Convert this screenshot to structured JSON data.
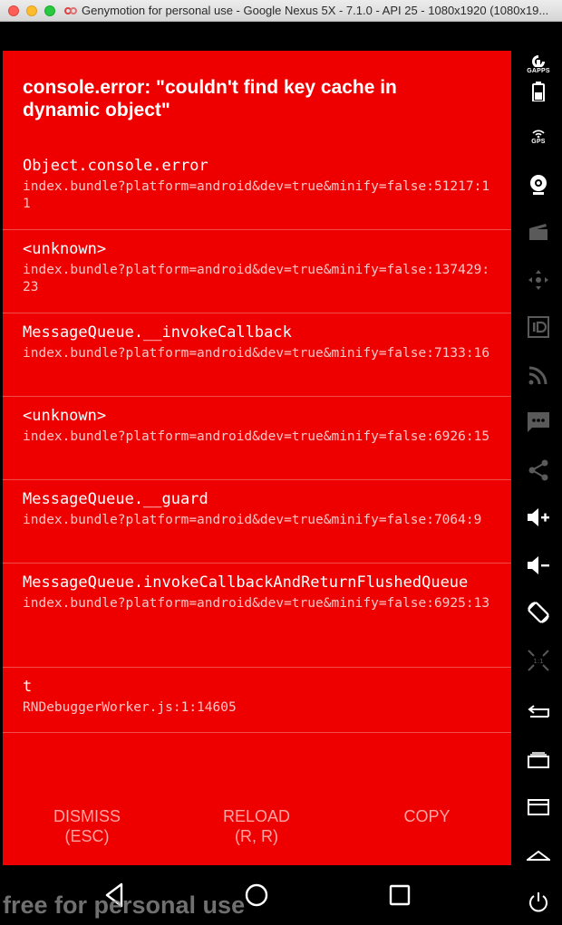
{
  "window": {
    "title": "Genymotion for personal use - Google Nexus 5X - 7.1.0 - API 25 - 1080x1920 (1080x19..."
  },
  "redbox": {
    "title": "console.error: \"couldn't find key cache in dynamic object\"",
    "frames": [
      {
        "method": "Object.console.error",
        "file": "index.bundle?platform=android&dev=true&minify=false:51217:11"
      },
      {
        "method": "<unknown>",
        "file": "index.bundle?platform=android&dev=true&minify=false:137429:23"
      },
      {
        "method": "MessageQueue.__invokeCallback",
        "file": "index.bundle?platform=android&dev=true&minify=false:7133:16"
      },
      {
        "method": "<unknown>",
        "file": "index.bundle?platform=android&dev=true&minify=false:6926:15"
      },
      {
        "method": "MessageQueue.__guard",
        "file": "index.bundle?platform=android&dev=true&minify=false:7064:9"
      },
      {
        "method": "MessageQueue.invokeCallbackAndReturnFlushedQueue",
        "file": "index.bundle?platform=android&dev=true&minify=false:6925:13"
      },
      {
        "method": "t",
        "file": "RNDebuggerWorker.js:1:14605"
      }
    ],
    "actions": {
      "dismiss": "DISMISS\n(ESC)",
      "reload": "RELOAD\n(R, R)",
      "copy": "COPY"
    }
  },
  "sidebar": {
    "gapps_label": "GAPPS",
    "gps_label": "GPS",
    "icons": [
      "gapps-icon",
      "battery-icon",
      "gps-icon",
      "webcam-icon",
      "capture-icon",
      "dpad-icon",
      "identifier-icon",
      "cast-icon",
      "sms-icon",
      "share-icon",
      "volume-up-icon",
      "volume-down-icon",
      "rotate-icon",
      "pixel-perfect-icon",
      "back-icon",
      "recent-apps-icon",
      "menu-icon",
      "home-icon",
      "power-icon"
    ]
  },
  "navbar": {
    "icons": [
      "nav-back-icon",
      "nav-home-icon",
      "nav-recent-icon"
    ]
  },
  "watermark": "free for personal use"
}
